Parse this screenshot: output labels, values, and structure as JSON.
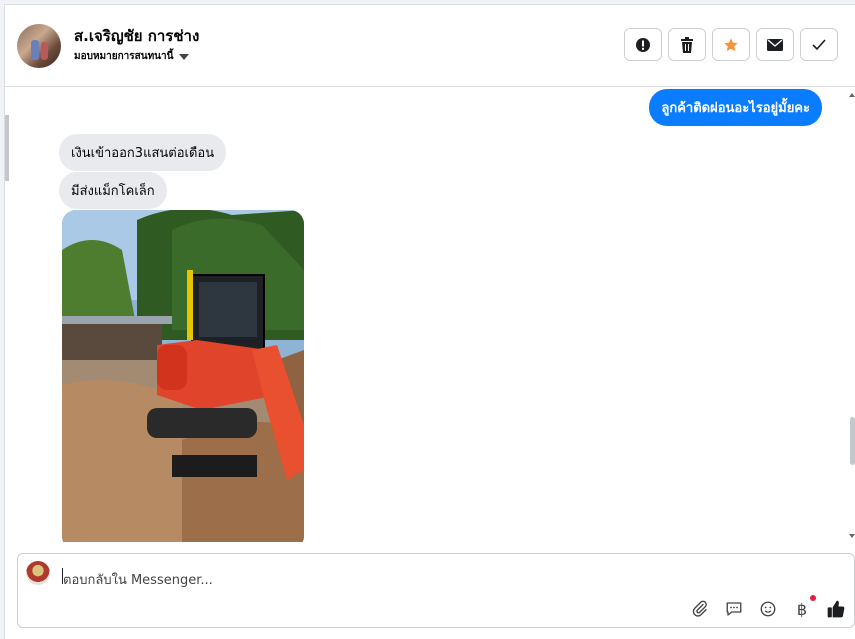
{
  "header": {
    "contact_name": "ส.เจริญชัย การช่าง",
    "assign_label": "มอบหมายการสนทนานี้",
    "actions": [
      {
        "icon": "alert-icon",
        "name": "mark-spam-button"
      },
      {
        "icon": "trash-icon",
        "name": "delete-button"
      },
      {
        "icon": "star-icon",
        "name": "star-button"
      },
      {
        "icon": "envelope-icon",
        "name": "mark-unread-button"
      },
      {
        "icon": "check-icon",
        "name": "mark-done-button"
      }
    ]
  },
  "messages": {
    "outgoing_1": "ลูกค้าติดผ่อนอะไรอยู่มั้ยคะ",
    "incoming_1": "เงินเข้าออก3แสนต่อเดือน",
    "incoming_2": "มีส่งแม็กโคเล็ก"
  },
  "composer": {
    "placeholder": "ตอบกลับใน Messenger...",
    "tools": [
      "paperclip-icon",
      "chat-bubble-icon",
      "smiley-icon",
      "baht-icon",
      "thumbs-up-icon"
    ]
  },
  "colors": {
    "accent": "#0a7cff",
    "star": "#f7923a",
    "incoming_bubble": "#e9eaed",
    "notification_dot": "#e41e3f"
  }
}
